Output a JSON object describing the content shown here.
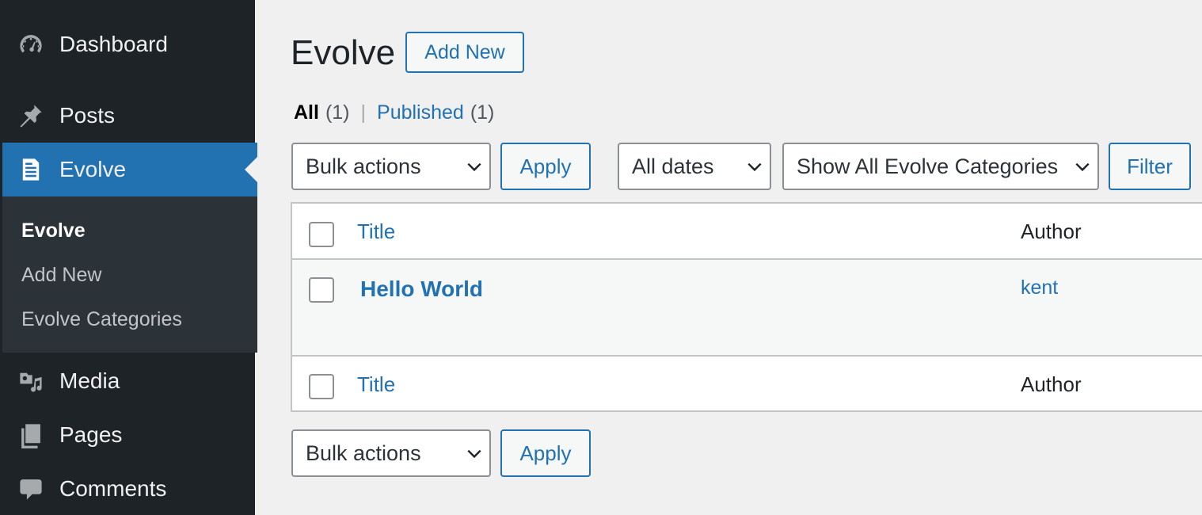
{
  "sidebar": {
    "dashboard": "Dashboard",
    "posts": "Posts",
    "evolve": "Evolve",
    "submenu": [
      "Evolve",
      "Add New",
      "Evolve Categories"
    ],
    "media": "Media",
    "pages": "Pages",
    "comments": "Comments"
  },
  "header": {
    "title": "Evolve",
    "add_new": "Add New"
  },
  "views": {
    "all": "All",
    "all_count": "(1)",
    "separator": "|",
    "published": "Published",
    "published_count": "(1)"
  },
  "toolbar_top": {
    "bulk_actions": "Bulk actions",
    "apply": "Apply",
    "dates": "All dates",
    "categories": "Show All Evolve Categories",
    "filter": "Filter"
  },
  "table": {
    "columns": [
      "Title",
      "Author"
    ],
    "rows": [
      {
        "title": "Hello World",
        "author": "kent"
      }
    ]
  },
  "toolbar_bottom": {
    "bulk_actions": "Bulk actions",
    "apply": "Apply"
  },
  "colors": {
    "sidebar_bg": "#1d2327",
    "accent": "#2271b1",
    "page_bg": "#f0f0f1"
  }
}
